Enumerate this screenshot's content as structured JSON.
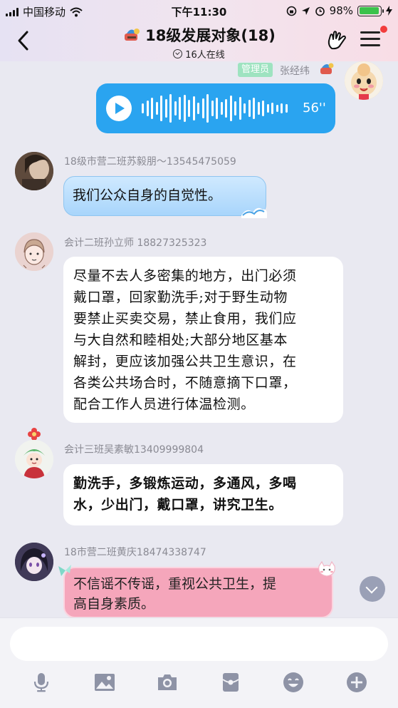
{
  "status_bar": {
    "carrier": "中国移动",
    "time": "下午11:30",
    "battery": "98%"
  },
  "header": {
    "title": "18级发展对象(18)",
    "online": "16人在线"
  },
  "messages": [
    {
      "type": "voice",
      "role_tag": "管理员",
      "sender": "张经纬",
      "duration": "56''"
    },
    {
      "type": "text",
      "sender": "18级市营二班苏毅朋～13545475059",
      "text": "我们公众自身的自觉性。"
    },
    {
      "type": "text",
      "sender": "会计二班孙立师  18827325323",
      "lines": [
        "尽量不去人多密集的地方，出门必须",
        "戴口罩，回家勤洗手;对于野生动物",
        "要禁止买卖交易，禁止食用，我们应",
        "与大自然和睦相处;大部分地区基本",
        "解封，更应该加强公共卫生意识，在",
        "各类公共场合时，不随意摘下口罩，",
        "配合工作人员进行体温检测。"
      ]
    },
    {
      "type": "text",
      "sender": "会计三班吴素敏13409999804",
      "lines": [
        "勤洗手，多锻炼运动，多通风，多喝",
        "水，少出门，戴口罩，讲究卫生。"
      ]
    },
    {
      "type": "text",
      "sender": "18市营二班黄庆18474338747",
      "lines": [
        "不信谣不传谣，重视公共卫生，提",
        "高自身素质。"
      ]
    }
  ],
  "input": {
    "placeholder": ""
  },
  "colors": {
    "voice_bubble": "#2aa4f0",
    "admin_tag": "#9ee3c0",
    "pink_bubble": "#f5a6bb",
    "badge": "#f23d3d"
  }
}
